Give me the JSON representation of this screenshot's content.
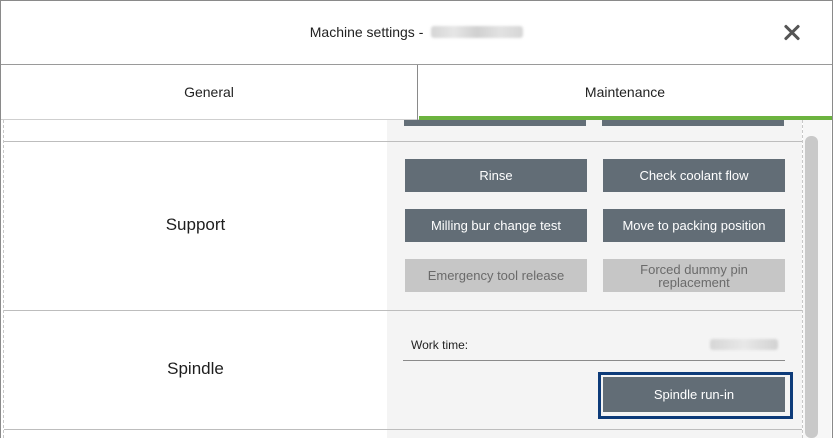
{
  "header": {
    "title": "Machine settings - "
  },
  "tabs": [
    {
      "label": "General",
      "active": false
    },
    {
      "label": "Maintenance",
      "active": true
    }
  ],
  "sections": {
    "support": {
      "label": "Support",
      "buttons": {
        "rinse": "Rinse",
        "check_coolant_flow": "Check coolant flow",
        "milling_bur_change_test": "Milling bur change test",
        "move_to_packing_position": "Move to packing position",
        "emergency_tool_release": "Emergency tool release",
        "forced_dummy_pin_replacement": "Forced dummy pin replacement"
      }
    },
    "spindle": {
      "label": "Spindle",
      "work_time_label": "Work time:",
      "run_in_button": "Spindle run-in"
    }
  },
  "colors": {
    "accent": "#6cb33f",
    "button": "#626d76",
    "button_disabled": "#c6c6c6",
    "focus": "#0d3b79"
  }
}
